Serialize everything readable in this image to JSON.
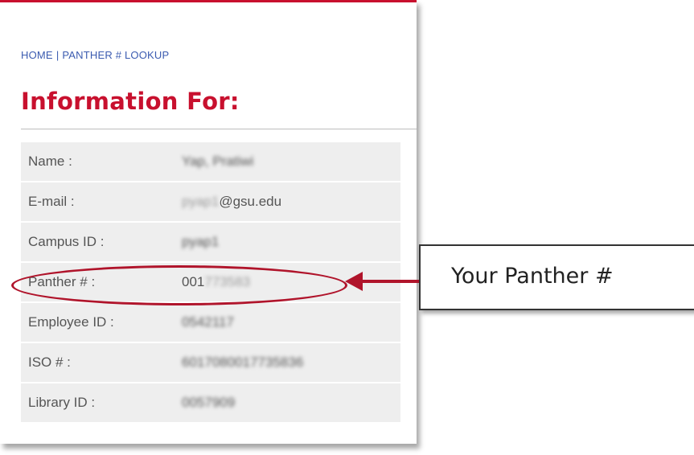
{
  "breadcrumb": {
    "home": "HOME",
    "separator": "|",
    "current": "PANTHER # LOOKUP"
  },
  "page_title": "Information For:",
  "rows": [
    {
      "label": "Name :",
      "value": "Yap, Pratiwi",
      "blurred": true
    },
    {
      "label": "E-mail :",
      "value_blurred": "pyap1",
      "value_suffix": "@gsu.edu",
      "blurred": "partial"
    },
    {
      "label": "Campus ID :",
      "value": "pyap1",
      "blurred": true
    },
    {
      "label": "Panther # :",
      "value_prefix": "001",
      "value_blurred": "773583",
      "blurred": "partial"
    },
    {
      "label": "Employee ID :",
      "value": "0542117",
      "blurred": true
    },
    {
      "label": "ISO # :",
      "value": "6017080017735836",
      "blurred": true
    },
    {
      "label": "Library ID :",
      "value": "0057909",
      "blurred": true
    }
  ],
  "callout": {
    "text": "Your Panther #"
  },
  "colors": {
    "accent": "#c8102e",
    "link": "#3b5bb0",
    "row_bg": "#eeeeee"
  }
}
